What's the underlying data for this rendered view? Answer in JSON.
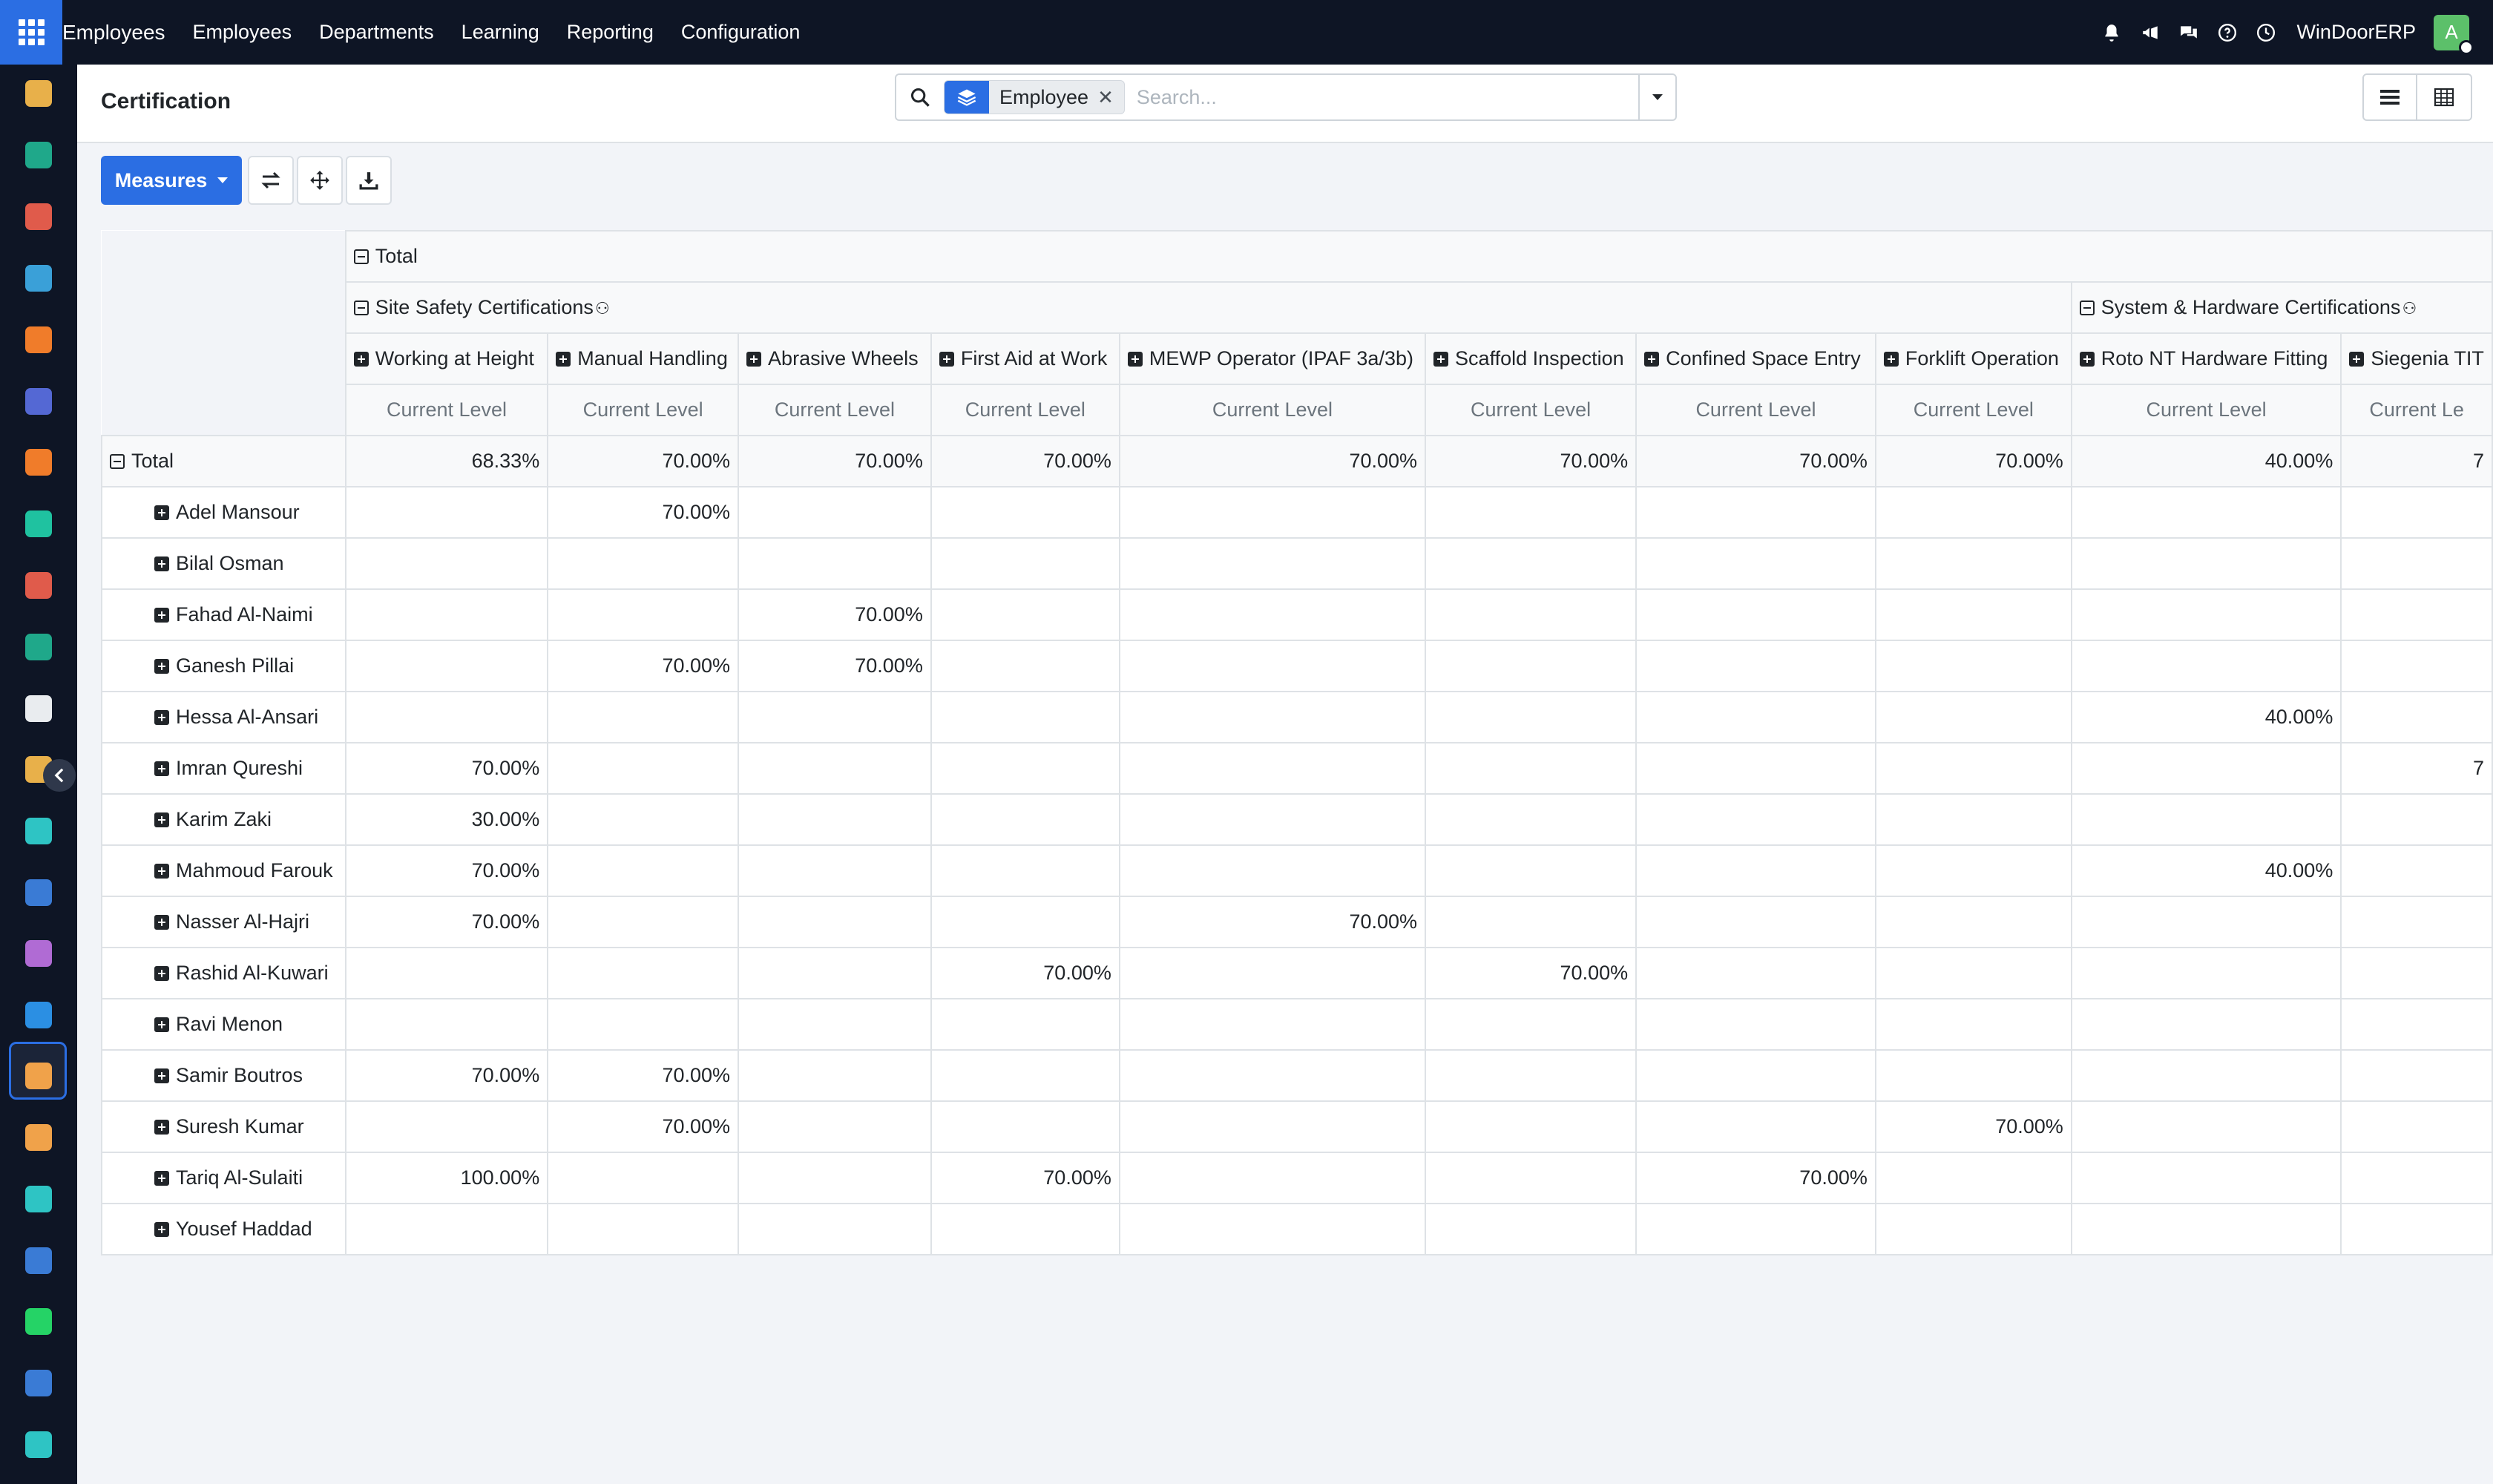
{
  "topbar": {
    "brand": "Employees",
    "menu": [
      "Employees",
      "Departments",
      "Learning",
      "Reporting",
      "Configuration"
    ],
    "company": "WinDoorERP",
    "avatar_letter": "A"
  },
  "control_panel": {
    "title": "Certification",
    "facet_label": "Employee",
    "facet_remove": "✕",
    "search_placeholder": "Search..."
  },
  "toolbar": {
    "measures_label": "Measures"
  },
  "pivot": {
    "total_header": "Total",
    "groups": [
      {
        "label": "Site Safety Certifications",
        "icon": "⚇"
      },
      {
        "label": "System & Hardware Certifications",
        "icon": "⚇"
      }
    ],
    "columns": [
      "Working at Height",
      "Manual Handling",
      "Abrasive Wheels",
      "First Aid at Work",
      "MEWP Operator (IPAF 3a/3b)",
      "Scaffold Inspection",
      "Confined Space Entry",
      "Forklift Operation",
      "Roto NT Hardware Fitting",
      "Siegenia TIT"
    ],
    "measure_label": "Current Level",
    "measure_label_truncated": "Current Le",
    "total_row": {
      "label": "Total",
      "values": [
        "68.33%",
        "70.00%",
        "70.00%",
        "70.00%",
        "70.00%",
        "70.00%",
        "70.00%",
        "70.00%",
        "40.00%",
        "7"
      ]
    },
    "rows": [
      {
        "label": "Adel Mansour",
        "values": [
          "",
          "70.00%",
          "",
          "",
          "",
          "",
          "",
          "",
          "",
          ""
        ]
      },
      {
        "label": "Bilal Osman",
        "values": [
          "",
          "",
          "",
          "",
          "",
          "",
          "",
          "",
          "",
          ""
        ]
      },
      {
        "label": "Fahad Al-Naimi",
        "values": [
          "",
          "",
          "70.00%",
          "",
          "",
          "",
          "",
          "",
          "",
          ""
        ]
      },
      {
        "label": "Ganesh Pillai",
        "values": [
          "",
          "70.00%",
          "70.00%",
          "",
          "",
          "",
          "",
          "",
          "",
          ""
        ]
      },
      {
        "label": "Hessa Al-Ansari",
        "values": [
          "",
          "",
          "",
          "",
          "",
          "",
          "",
          "",
          "40.00%",
          ""
        ]
      },
      {
        "label": "Imran Qureshi",
        "values": [
          "70.00%",
          "",
          "",
          "",
          "",
          "",
          "",
          "",
          "",
          "7"
        ]
      },
      {
        "label": "Karim Zaki",
        "values": [
          "30.00%",
          "",
          "",
          "",
          "",
          "",
          "",
          "",
          "",
          ""
        ]
      },
      {
        "label": "Mahmoud Farouk",
        "values": [
          "70.00%",
          "",
          "",
          "",
          "",
          "",
          "",
          "",
          "40.00%",
          ""
        ]
      },
      {
        "label": "Nasser Al-Hajri",
        "values": [
          "70.00%",
          "",
          "",
          "",
          "70.00%",
          "",
          "",
          "",
          "",
          ""
        ]
      },
      {
        "label": "Rashid Al-Kuwari",
        "values": [
          "",
          "",
          "",
          "70.00%",
          "",
          "70.00%",
          "",
          "",
          "",
          ""
        ]
      },
      {
        "label": "Ravi Menon",
        "values": [
          "",
          "",
          "",
          "",
          "",
          "",
          "",
          "",
          "",
          ""
        ]
      },
      {
        "label": "Samir Boutros",
        "values": [
          "70.00%",
          "70.00%",
          "",
          "",
          "",
          "",
          "",
          "",
          "",
          ""
        ]
      },
      {
        "label": "Suresh Kumar",
        "values": [
          "",
          "70.00%",
          "",
          "",
          "",
          "",
          "",
          "70.00%",
          "",
          ""
        ]
      },
      {
        "label": "Tariq Al-Sulaiti",
        "values": [
          "100.00%",
          "",
          "",
          "70.00%",
          "",
          "",
          "70.00%",
          "",
          "",
          ""
        ]
      },
      {
        "label": "Yousef Haddad",
        "values": [
          "",
          "",
          "",
          "",
          "",
          "",
          "",
          "",
          "",
          ""
        ]
      }
    ]
  },
  "colors": {
    "navbar": "#0e1525",
    "primary": "#2b6ee3",
    "background": "#f2f4f8"
  },
  "rail_icons": [
    {
      "name": "documents-app-icon",
      "color": "#e8b04a"
    },
    {
      "name": "employees-app-icon",
      "color": "#1fa88a"
    },
    {
      "name": "reporting-app-icon",
      "color": "#e05b4b"
    },
    {
      "name": "timesheets-app-icon",
      "color": "#3aa0d8"
    },
    {
      "name": "discuss-app-icon",
      "color": "#f07c2a"
    },
    {
      "name": "mail-app-icon",
      "color": "#5468d4"
    },
    {
      "name": "chat-app-icon",
      "color": "#f07c2a"
    },
    {
      "name": "sales-app-icon",
      "color": "#1fc2a0"
    },
    {
      "name": "dashboard-app-icon",
      "color": "#e05b4b"
    },
    {
      "name": "contacts-app-icon",
      "color": "#1fa88a"
    },
    {
      "name": "inventory-app-icon",
      "color": "#e9ecef"
    },
    {
      "name": "knowledge-app-icon",
      "color": "#e8b04a"
    },
    {
      "name": "tasks-app-icon",
      "color": "#2ec4c4"
    },
    {
      "name": "elearning-app-icon",
      "color": "#3a7bd5"
    },
    {
      "name": "apps-app-icon",
      "color": "#b06bd4"
    },
    {
      "name": "invoicing-app-icon",
      "color": "#2b8fe3"
    },
    {
      "name": "skills-app-icon",
      "color": "#f0a24a"
    },
    {
      "name": "calendar-app-icon",
      "color": "#f0a24a"
    },
    {
      "name": "sign-app-icon",
      "color": "#2ec4c4"
    },
    {
      "name": "website-app-icon",
      "color": "#3a7bd5"
    },
    {
      "name": "whatsapp-app-icon",
      "color": "#25d366"
    },
    {
      "name": "planning-app-icon",
      "color": "#3a7bd5"
    },
    {
      "name": "analytics-app-icon",
      "color": "#2ec4c4"
    }
  ]
}
